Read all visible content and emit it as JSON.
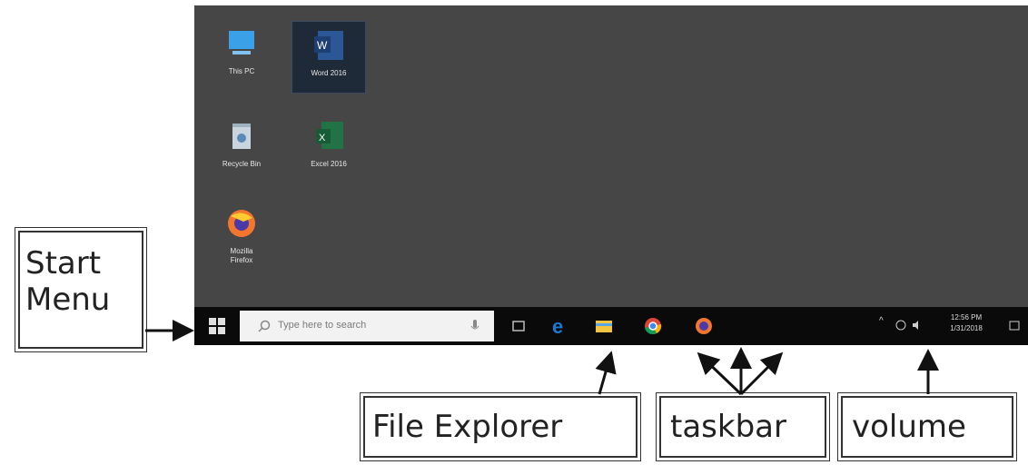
{
  "desktop": {
    "icons": [
      {
        "label": "This PC",
        "icon": "this-pc-icon"
      },
      {
        "label": "Word 2016",
        "icon": "word-icon"
      },
      {
        "label": "Recycle Bin",
        "icon": "recycle-bin-icon"
      },
      {
        "label": "Excel 2016",
        "icon": "excel-icon"
      },
      {
        "label": "Mozilla Firefox",
        "icon": "firefox-icon"
      }
    ]
  },
  "taskbar": {
    "search_placeholder": "Type here to search",
    "time": "12:56 PM",
    "date": "1/31/2018",
    "tray_text": "^"
  },
  "callouts": {
    "start_menu": "Start\nMenu",
    "file_explorer": "File Explorer",
    "taskbar": "taskbar",
    "volume": "volume"
  },
  "colors": {
    "desktop": "#464646",
    "taskbar": "#0a0a0a",
    "edge": "#1a78d6",
    "word": "#2b5797",
    "excel": "#217346"
  }
}
